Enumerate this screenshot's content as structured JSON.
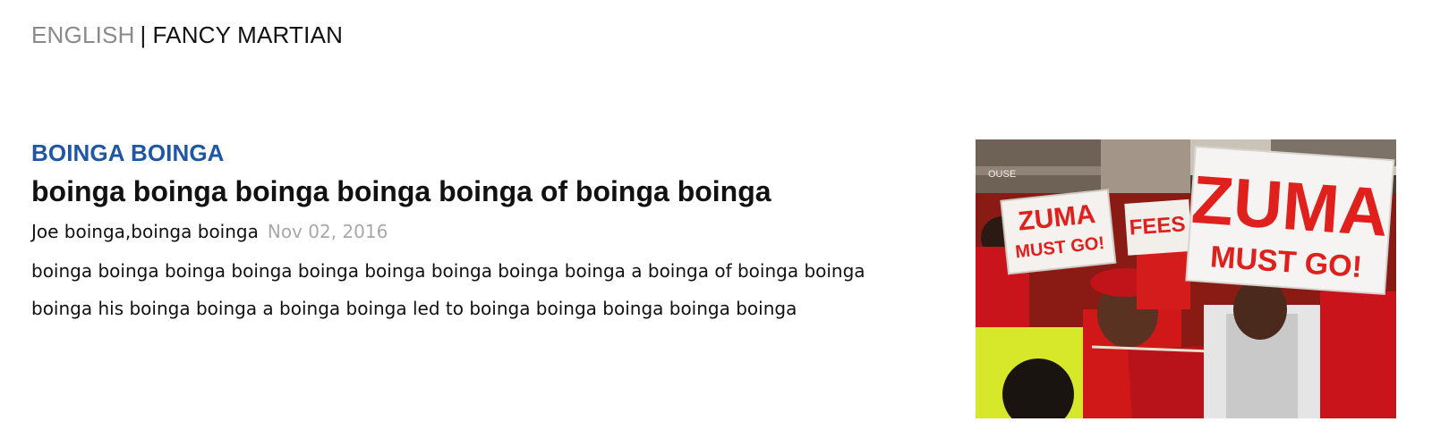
{
  "nav": {
    "english": "ENGLISH",
    "separator": "|",
    "fancy": "FANCY MARTIAN"
  },
  "article": {
    "category": "BOINGA BOINGA",
    "headline": "boinga boinga boinga boinga boinga of boinga boinga",
    "author": "Joe boinga,boinga boinga",
    "date": "Nov 02, 2016",
    "summary": "boinga boinga boinga boinga boinga boinga boinga boinga boinga a boinga of boinga boinga boinga his boinga boinga a boinga boinga led to boinga boinga boinga boinga boinga"
  },
  "photo": {
    "sign_large_line1": "ZUMA",
    "sign_large_line2": "MUST GO!",
    "sign_small_line1": "ZUMA",
    "sign_small_line2": "MUST GO!",
    "sign_mid_text": "FEES",
    "building_text": "OUSE"
  },
  "colors": {
    "nav_muted": "#8a8a8a",
    "category_blue": "#1f57a4",
    "date_gray": "#a8a8a8",
    "sign_red": "#e0201c",
    "shirt_red": "#c8141a"
  }
}
